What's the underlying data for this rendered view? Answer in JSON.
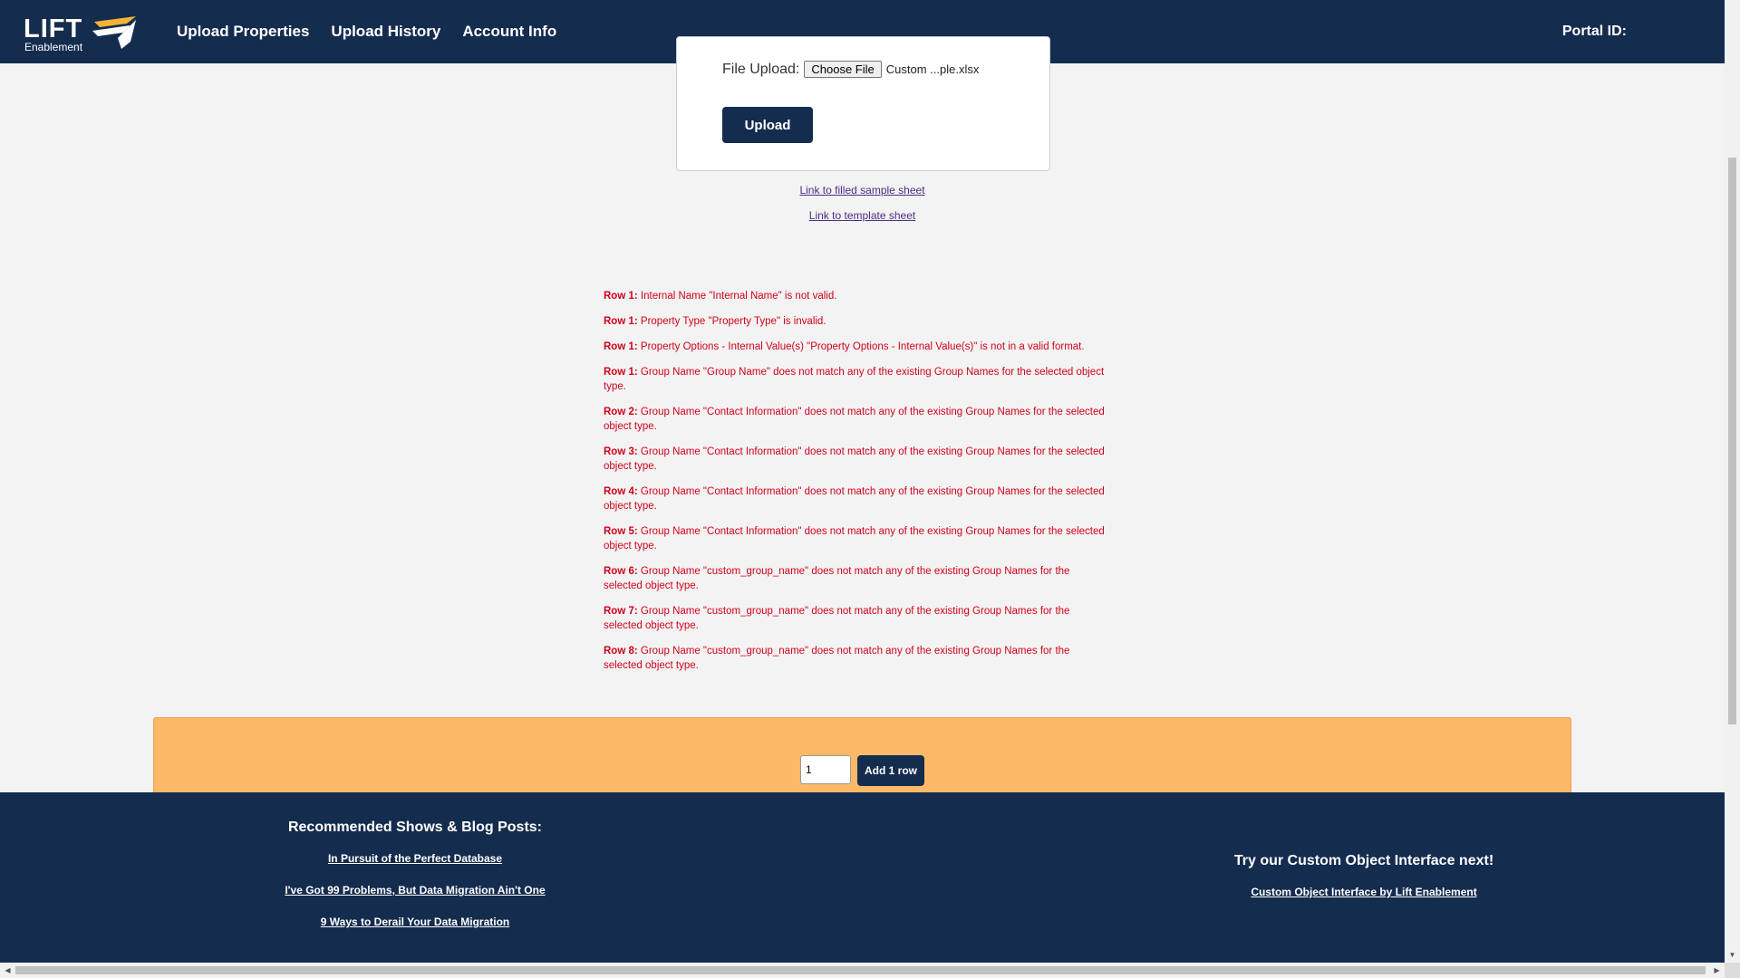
{
  "brand": {
    "name": "LIFT",
    "sub": "Enablement"
  },
  "nav": {
    "items": [
      "Upload Properties",
      "Upload History",
      "Account Info"
    ]
  },
  "portal": {
    "label": "Portal ID:"
  },
  "upload": {
    "file_label": "File Upload:",
    "choose_label": "Choose File",
    "file_name": "Custom ...ple.xlsx",
    "button": "Upload"
  },
  "links": {
    "sample": "Link to filled sample sheet",
    "template": "Link to template sheet"
  },
  "errors": [
    {
      "row": "Row 1:",
      "msg": "Internal Name \"Internal Name\" is not valid."
    },
    {
      "row": "Row 1:",
      "msg": "Property Type \"Property Type\" is invalid."
    },
    {
      "row": "Row 1:",
      "msg": "Property Options - Internal Value(s) \"Property Options - Internal Value(s)\" is not in a valid format."
    },
    {
      "row": "Row 1:",
      "msg": "Group Name \"Group Name\" does not match any of the existing Group Names for the selected object type."
    },
    {
      "row": "Row 2:",
      "msg": "Group Name \"Contact Information\" does not match any of the existing Group Names for the selected object type."
    },
    {
      "row": "Row 3:",
      "msg": "Group Name \"Contact Information\" does not match any of the existing Group Names for the selected object type."
    },
    {
      "row": "Row 4:",
      "msg": "Group Name \"Contact Information\" does not match any of the existing Group Names for the selected object type."
    },
    {
      "row": "Row 5:",
      "msg": "Group Name \"Contact Information\" does not match any of the existing Group Names for the selected object type."
    },
    {
      "row": "Row 6:",
      "msg": "Group Name \"custom_group_name\" does not match any of the existing Group Names for the selected object type."
    },
    {
      "row": "Row 7:",
      "msg": "Group Name \"custom_group_name\" does not match any of the existing Group Names for the selected object type."
    },
    {
      "row": "Row 8:",
      "msg": "Group Name \"custom_group_name\" does not match any of the existing Group Names for the selected object type."
    }
  ],
  "rows_control": {
    "value": "1",
    "button": "Add 1 row"
  },
  "footer": {
    "rec_title": "Recommended Shows & Blog Posts:",
    "rec_links": [
      "In Pursuit of the Perfect Database",
      "I've Got 99 Problems, But Data Migration Ain't One",
      "9 Ways to Derail Your Data Migration"
    ],
    "try_title": "Try our Custom Object Interface next!",
    "try_link": "Custom Object Interface by Lift Enablement"
  },
  "colors": {
    "navy": "#142c4e",
    "orange": "#fdb967",
    "error": "#d0021b",
    "gold": "#f5b335"
  }
}
